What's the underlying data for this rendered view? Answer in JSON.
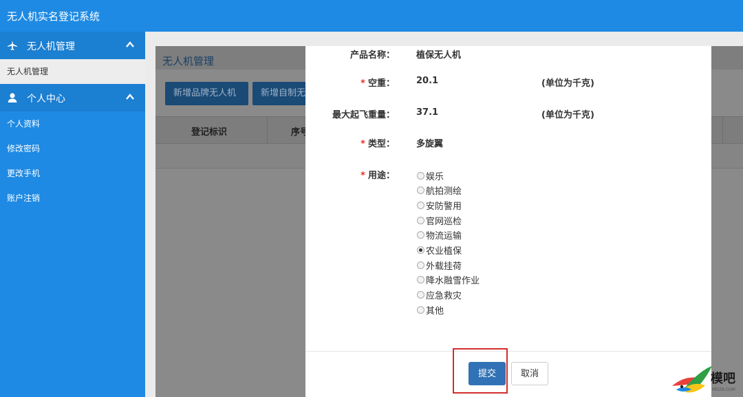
{
  "app": {
    "title": "无人机实名登记系统"
  },
  "sidebar": {
    "groups": [
      {
        "label": "无人机管理",
        "icon": "airplane-icon",
        "items": [
          "无人机管理"
        ]
      },
      {
        "label": "个人中心",
        "icon": "user-icon",
        "items": [
          "个人资料",
          "修改密码",
          "更改手机",
          "账户注销"
        ]
      }
    ]
  },
  "background": {
    "panel_title": "无人机管理",
    "buttons": [
      "新增品牌无人机",
      "新增自制无"
    ],
    "columns": [
      "登记标识",
      "序号"
    ]
  },
  "form": {
    "product_name": {
      "label": "产品名称：",
      "value": "植保无人机"
    },
    "empty_weight": {
      "required": "*",
      "label": "空重：",
      "value": "20.1",
      "unit": "(单位为千克)"
    },
    "max_takeoff": {
      "label": "最大起飞重量：",
      "value": "37.1",
      "unit": "(单位为千克)"
    },
    "type": {
      "required": "*",
      "label": "类型：",
      "value": "多旋翼"
    },
    "usage": {
      "required": "*",
      "label": "用途：",
      "selected": "农业植保",
      "options": [
        "娱乐",
        "航拍测绘",
        "安防警用",
        "官网巡检",
        "物流运输",
        "农业植保",
        "外载挂荷",
        "降水融雪作业",
        "应急救灾",
        "其他"
      ]
    }
  },
  "actions": {
    "submit": "提交",
    "cancel": "取消"
  },
  "watermark": {
    "text": "模吧",
    "sub": "MOZ8.COM"
  },
  "colors": {
    "primary": "#1e8ae3",
    "submit": "#3072b5",
    "required": "#e0322b",
    "highlight": "#d22d2d"
  }
}
